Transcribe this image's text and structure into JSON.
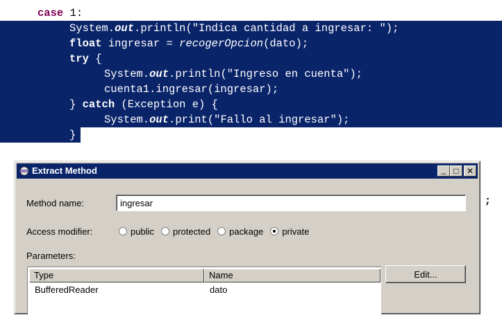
{
  "editor": {
    "line0": {
      "kw": "case",
      "rest": " 1:"
    },
    "line1": {
      "a": "System.",
      "b": "out",
      "c": ".println(\"Indica cantidad a ingresar: \");"
    },
    "line2": {
      "kw": "float",
      "a": " ingresar = ",
      "it": "recogerOpcion",
      "b": "(dato);"
    },
    "line3": {
      "kw": "try",
      "rest": " {"
    },
    "line4": {
      "a": "System.",
      "b": "out",
      "c": ".println(\"Ingreso en cuenta\");"
    },
    "line5": {
      "a": "cuenta1.ingresar(ingresar);"
    },
    "line6": {
      "a": "} ",
      "kw": "catch",
      "b": " (Exception e) {"
    },
    "line7": {
      "a": "System.",
      "b": "out",
      "c": ".print(\"Fallo al ingresar\");"
    },
    "line8": {
      "a": "}"
    },
    "trailing": ";"
  },
  "dialog": {
    "title": "Extract Method",
    "minimize": "_",
    "maximize": "□",
    "close": "✕",
    "method_name_label": "Method name:",
    "method_name_value": "ingresar",
    "access_label": "Access modifier:",
    "access_options": [
      {
        "label": "public",
        "checked": false
      },
      {
        "label": "protected",
        "checked": false
      },
      {
        "label": "package",
        "checked": false
      },
      {
        "label": "private",
        "checked": true
      }
    ],
    "parameters_label": "Parameters:",
    "table": {
      "columns": [
        "Type",
        "Name"
      ],
      "rows": [
        [
          "BufferedReader",
          "dato"
        ]
      ]
    },
    "edit_button": "Edit..."
  },
  "colors": {
    "selection": "#0a246a",
    "dialog_bg": "#d4d0c8",
    "keyword": "#7f0055"
  }
}
